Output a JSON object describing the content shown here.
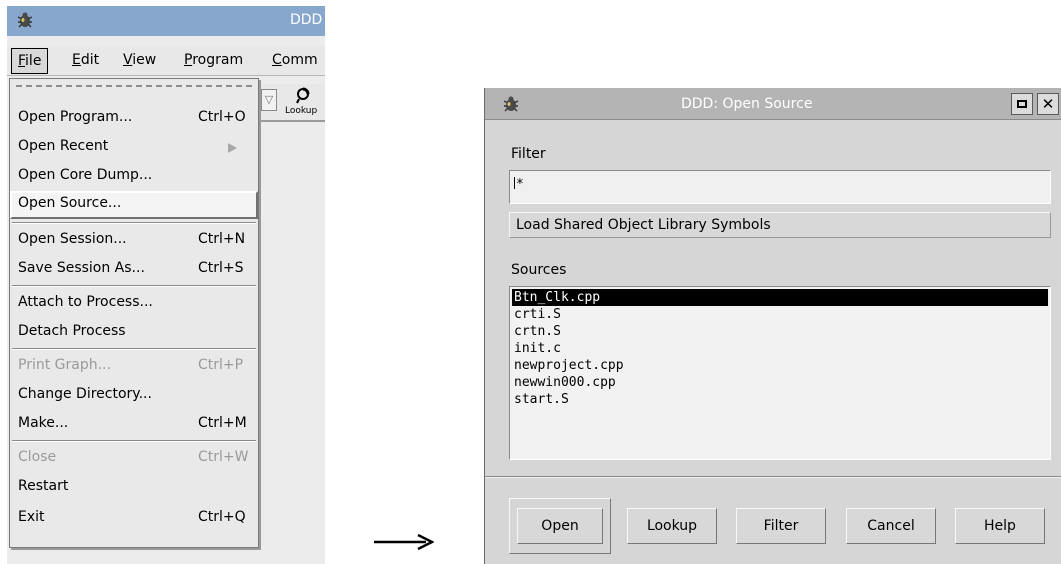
{
  "ddd_window": {
    "title": "DDD",
    "menubar": [
      {
        "label": "File"
      },
      {
        "label": "Edit"
      },
      {
        "label": "View"
      },
      {
        "label": "Program"
      },
      {
        "label": "Comm"
      }
    ],
    "toolbar": {
      "lookup_label": "Lookup"
    }
  },
  "file_menu": {
    "items": [
      {
        "label": "Open Program...",
        "shortcut": "Ctrl+O"
      },
      {
        "label": "Open Recent",
        "shortcut": ""
      },
      {
        "label": "Open Core Dump...",
        "shortcut": ""
      },
      {
        "label": "Open Source...",
        "shortcut": "",
        "highlighted": true
      },
      {
        "label": "Open Session...",
        "shortcut": "Ctrl+N"
      },
      {
        "label": "Save Session As...",
        "shortcut": "Ctrl+S"
      },
      {
        "label": "Attach to Process...",
        "shortcut": ""
      },
      {
        "label": "Detach Process",
        "shortcut": ""
      },
      {
        "label": "Print Graph...",
        "shortcut": "Ctrl+P",
        "disabled": true
      },
      {
        "label": "Change Directory...",
        "shortcut": ""
      },
      {
        "label": "Make...",
        "shortcut": "Ctrl+M"
      },
      {
        "label": "Close",
        "shortcut": "Ctrl+W",
        "disabled": true
      },
      {
        "label": "Restart",
        "shortcut": ""
      },
      {
        "label": "Exit",
        "shortcut": "Ctrl+Q"
      }
    ]
  },
  "arrow_glyph": "⟶",
  "dialog": {
    "title": "DDD: Open Source",
    "filter_label": "Filter",
    "filter_value": "*",
    "load_shared_label": "Load Shared Object Library Symbols",
    "sources_label": "Sources",
    "sources": [
      "Btn_Clk.cpp",
      "crti.S",
      "crtn.S",
      "init.c",
      "newproject.cpp",
      "newwin000.cpp",
      "start.S"
    ],
    "selected_source": "Btn_Clk.cpp",
    "buttons": {
      "open": "Open",
      "lookup": "Lookup",
      "filter": "Filter",
      "cancel": "Cancel",
      "help": "Help"
    },
    "close_glyph": "✕"
  },
  "colors": {
    "titlebar_active": "#87a8cc",
    "titlebar_dialog": "#b4b4b4",
    "selection": "#000000"
  }
}
